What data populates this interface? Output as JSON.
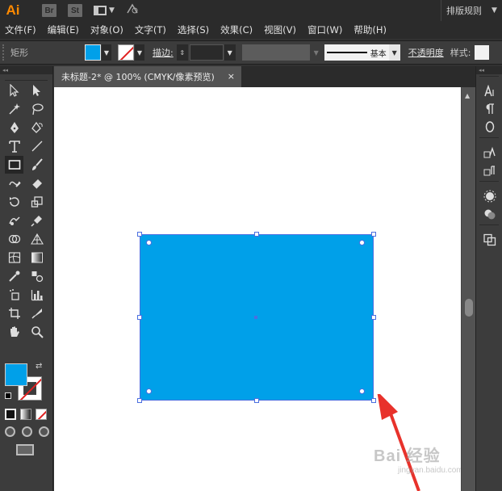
{
  "app": {
    "logo": "Ai",
    "bridge_label": "Br",
    "stock_label": "St",
    "workspace_name": "排版规则"
  },
  "menu": [
    "文件(F)",
    "编辑(E)",
    "对象(O)",
    "文字(T)",
    "选择(S)",
    "效果(C)",
    "视图(V)",
    "窗口(W)",
    "帮助(H)"
  ],
  "control_bar": {
    "selection_label": "矩形",
    "fill_color": "#00a0e9",
    "stroke_color": "none",
    "stroke_label": "描边:",
    "stroke_weight": "",
    "brush_label": "基本",
    "opacity_label": "不透明度",
    "style_label": "样式:"
  },
  "document": {
    "tab_title": "未标题-2* @ 100% (CMYK/像素预览)",
    "close_label": "×"
  },
  "shape": {
    "type": "rectangle",
    "fill": "#00a0e9",
    "selected": true
  },
  "annotation": {
    "arrow_color": "#e8322b"
  },
  "watermark": {
    "main": "Bai 经验",
    "sub": "jingyan.baidu.com"
  },
  "icons": {
    "left_tools": [
      "selection-icon",
      "direct-selection-icon",
      "magic-wand-icon",
      "lasso-icon",
      "pen-icon",
      "curvature-icon",
      "type-icon",
      "line-segment-icon",
      "rectangle-icon",
      "paintbrush-icon",
      "shaper-icon",
      "eraser-icon",
      "rotate-icon",
      "scale-icon",
      "warp-icon",
      "free-transform-icon",
      "shape-builder-icon",
      "perspective-grid-icon",
      "mesh-icon",
      "gradient-icon",
      "eyedropper-icon",
      "blend-icon",
      "symbol-sprayer-icon",
      "column-graph-icon",
      "artboard-icon",
      "slice-icon",
      "hand-icon",
      "zoom-icon"
    ],
    "right_panel": [
      "character-icon",
      "paragraph-icon",
      "opentype-icon",
      "character-styles-icon",
      "paragraph-styles-icon",
      "appearance-icon",
      "graphic-styles-icon",
      "layers-icon"
    ]
  }
}
